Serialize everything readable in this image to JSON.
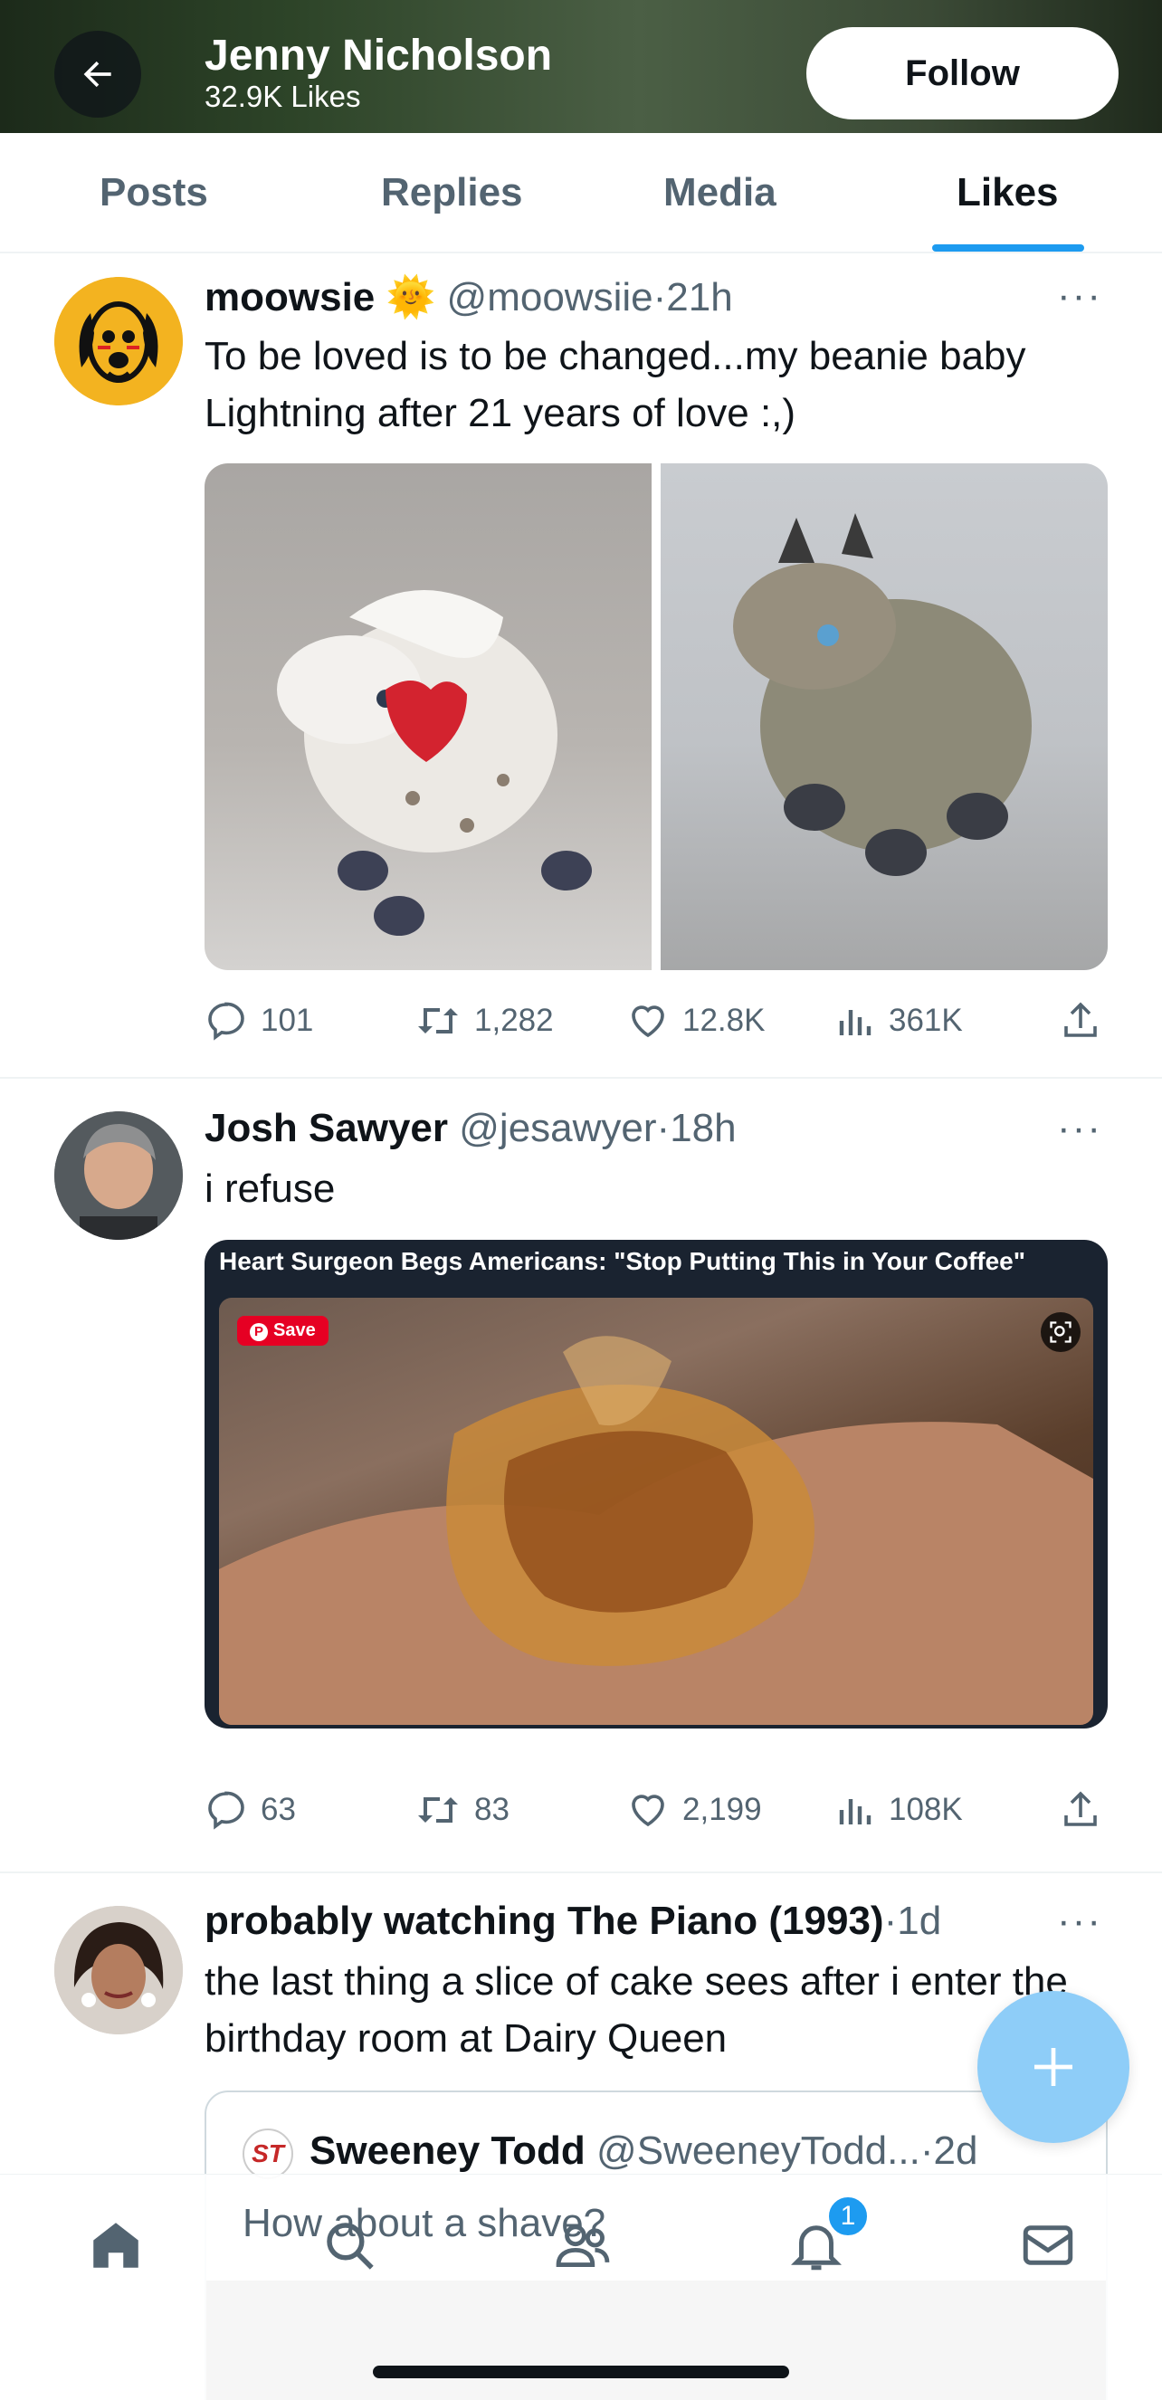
{
  "header": {
    "name": "Jenny Nicholson",
    "likes_count": "32.9K Likes",
    "follow_label": "Follow"
  },
  "tabs": [
    {
      "label": "Posts",
      "active": false
    },
    {
      "label": "Replies",
      "active": false
    },
    {
      "label": "Media",
      "active": false
    },
    {
      "label": "Likes",
      "active": true
    }
  ],
  "tweets": [
    {
      "name": "moowsie",
      "emoji": "🌞",
      "handle": "@moowsiie",
      "time": "21h",
      "text": "To be loved is to be changed...my beanie baby Lightning after 21 years of love :,)",
      "replies": "101",
      "retweets": "1,282",
      "likes": "12.8K",
      "views": "361K"
    },
    {
      "name": "Josh Sawyer",
      "handle": "@jesawyer",
      "time": "18h",
      "text": "i refuse",
      "card_title": "Heart Surgeon Begs Americans: \"Stop Putting This in Your Coffee\"",
      "card_save": "Save",
      "replies": "63",
      "retweets": "83",
      "likes": "2,199",
      "views": "108K"
    },
    {
      "name": "probably watching The Piano (1993)",
      "handle": "",
      "time": "1d",
      "text": "the last thing a slice of cake sees after i enter the birthday room at Dairy Queen",
      "quote": {
        "avatar_text": "ST",
        "name": "Sweeney Todd",
        "handle": "@SweeneyTodd...",
        "time": "2d"
      }
    }
  ],
  "compose_placeholder": "How about a shave?",
  "notifications_badge": "1",
  "dot": "·",
  "more": "···",
  "colors": {
    "accent": "#1d9bf0",
    "fab": "#8ecdf8",
    "text": "#0f1419",
    "muted": "#536471"
  },
  "icons": [
    "back-arrow-icon",
    "reply-icon",
    "retweet-icon",
    "like-icon",
    "views-icon",
    "share-icon",
    "home-icon",
    "search-icon",
    "communities-icon",
    "bell-icon",
    "mail-icon",
    "plus-icon"
  ]
}
